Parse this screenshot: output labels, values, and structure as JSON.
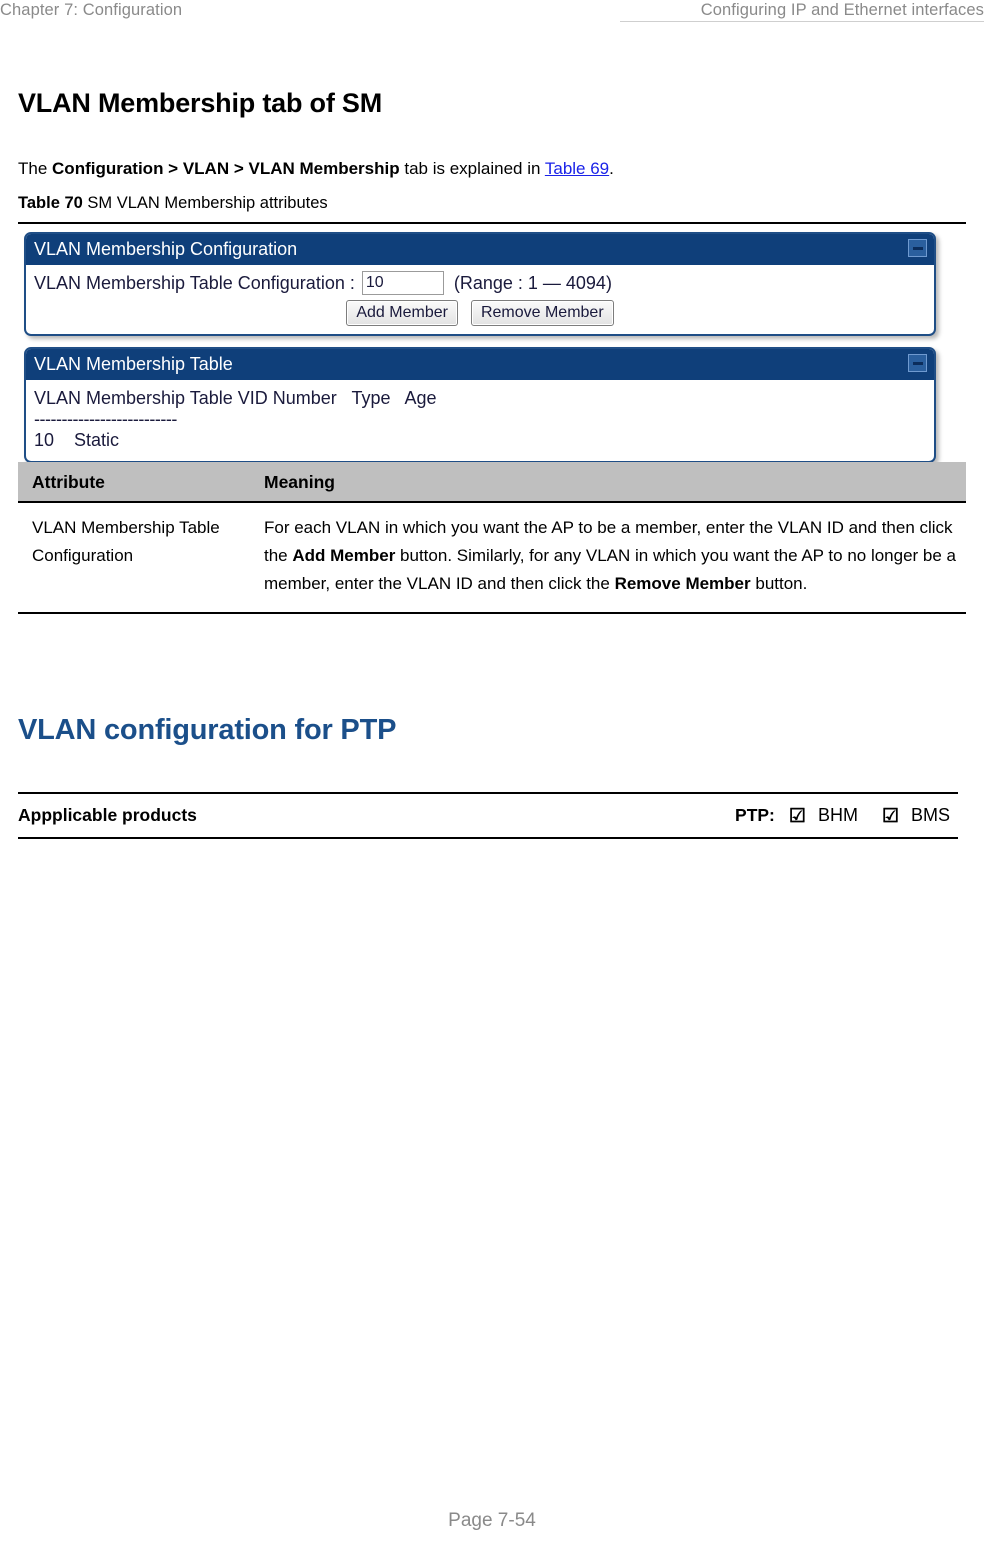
{
  "header": {
    "left": "Chapter 7:  Configuration",
    "right": "Configuring IP and Ethernet interfaces"
  },
  "section1": {
    "title": "VLAN Membership tab of SM",
    "intro": {
      "prefix": "The ",
      "path": "Configuration > VLAN > VLAN Membership",
      "middle": " tab is explained in ",
      "xref": "Table 69",
      "suffix": "."
    },
    "table_caption": {
      "number": "Table 70",
      "text": "SM VLAN Membership attributes"
    }
  },
  "screenshot": {
    "panel1": {
      "title": "VLAN Membership Configuration",
      "collapse_icon": "minimize-icon",
      "field_label": "VLAN Membership Table Configuration :",
      "field_value": "10",
      "range_text": "(Range : 1 — 4094)",
      "buttons": [
        "Add Member",
        "Remove Member"
      ]
    },
    "panel2": {
      "title": "VLAN Membership Table",
      "collapse_icon": "minimize-icon",
      "column_header": "VLAN Membership Table VID Number   Type   Age",
      "divider": "--------------------------",
      "rows": [
        "10    Static"
      ]
    }
  },
  "attributes_table": {
    "headers": [
      "Attribute",
      "Meaning"
    ],
    "rows": [
      {
        "attribute": "VLAN Membership Table Configuration",
        "meaning": {
          "part1": "For each VLAN in which you want the AP to be a member, enter the VLAN ID and then click the ",
          "bold1": "Add Member",
          "part2": " button. Similarly, for any VLAN in which you want the AP to no longer be a member, enter the VLAN ID and then click the ",
          "bold2": "Remove Member",
          "part3": " button."
        }
      }
    ]
  },
  "section2": {
    "title": "VLAN configuration for PTP",
    "applicable": {
      "label": "Appplicable products",
      "group_label": "PTP:",
      "products": [
        {
          "name": "BHM",
          "checked": true,
          "checkbox_glyph": "☑"
        },
        {
          "name": "BMS",
          "checked": true,
          "checkbox_glyph": "☑"
        }
      ]
    }
  },
  "footer": {
    "page": "Page 7-54"
  }
}
